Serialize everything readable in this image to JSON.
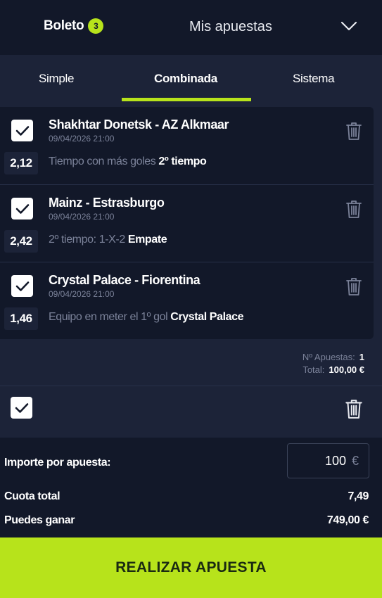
{
  "header": {
    "boleto_label": "Boleto",
    "boleto_count": "3",
    "mis_apuestas_label": "Mis apuestas"
  },
  "tabs": [
    {
      "label": "Simple",
      "active": false
    },
    {
      "label": "Combinada",
      "active": true
    },
    {
      "label": "Sistema",
      "active": false
    }
  ],
  "bets": [
    {
      "odds": "2,12",
      "title": "Shakhtar Donetsk - AZ Alkmaar",
      "date": "09/04/2026 21:00",
      "market": "Tiempo con más goles",
      "selection": "2º tiempo",
      "checked": true
    },
    {
      "odds": "2,42",
      "title": "Mainz - Estrasburgo",
      "date": "09/04/2026 21:00",
      "market": "2º tiempo: 1-X-2",
      "selection": "Empate",
      "checked": true
    },
    {
      "odds": "1,46",
      "title": "Crystal Palace - Fiorentina",
      "date": "09/04/2026 21:00",
      "market": "Equipo en meter el 1º gol",
      "selection": "Crystal Palace",
      "checked": true
    }
  ],
  "summary": {
    "num_label": "Nº Apuestas:",
    "num_value": "1",
    "total_label": "Total:",
    "total_value": "100,00 €"
  },
  "bottom": {
    "stake_label": "Importe por apuesta:",
    "stake_value": "100",
    "stake_currency": "€",
    "cuota_label": "Cuota total",
    "cuota_value": "7,49",
    "ganar_label": "Puedes ganar",
    "ganar_value": "749,00 €"
  },
  "cta_label": "REALIZAR APUESTA",
  "colors": {
    "accent": "#b7e31b",
    "panel": "#121829",
    "background": "#1c2338",
    "muted_text": "#7b8299"
  }
}
